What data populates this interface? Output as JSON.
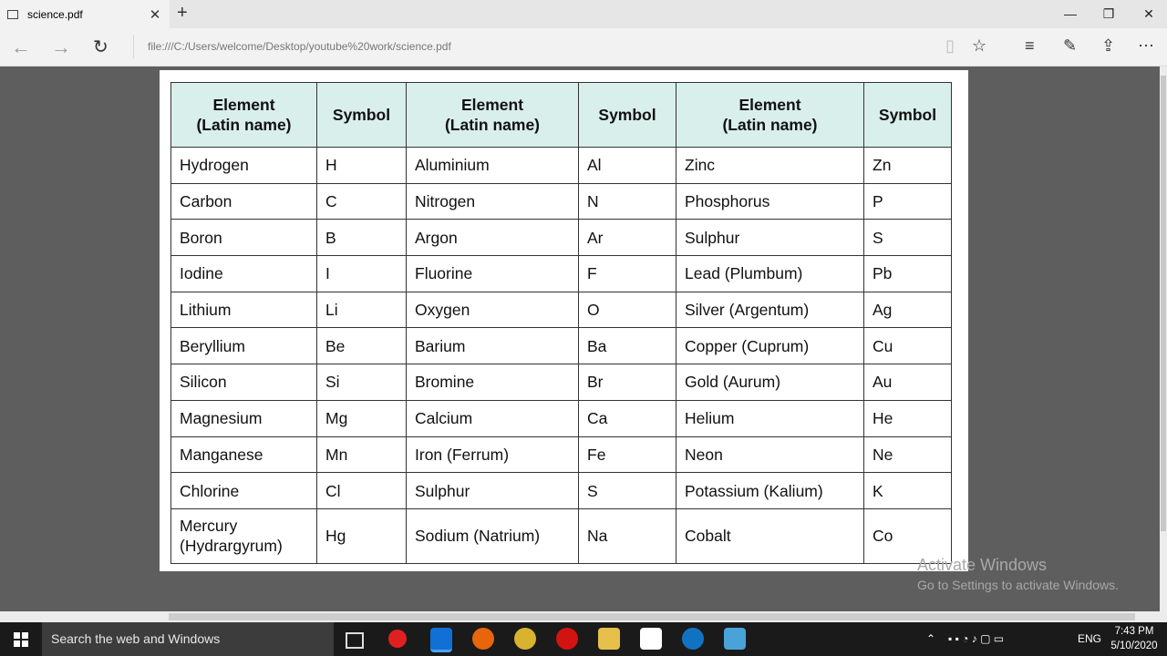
{
  "browser": {
    "tab_title": "science.pdf",
    "url": "file:///C:/Users/welcome/Desktop/youtube%20work/science.pdf",
    "window_controls": {
      "minimize": "—",
      "maximize": "❐",
      "close": "✕"
    }
  },
  "table": {
    "headers": [
      "Element\n(Latin name)",
      "Symbol",
      "Element\n(Latin name)",
      "Symbol",
      "Element\n(Latin name)",
      "Symbol"
    ],
    "rows": [
      [
        "Hydrogen",
        "H",
        "Aluminium",
        "Al",
        "Zinc",
        "Zn"
      ],
      [
        "Carbon",
        "C",
        "Nitrogen",
        "N",
        "Phosphorus",
        "P"
      ],
      [
        "Boron",
        "B",
        "Argon",
        "Ar",
        "Sulphur",
        "S"
      ],
      [
        "Iodine",
        "I",
        "Fluorine",
        "F",
        "Lead (Plumbum)",
        "Pb"
      ],
      [
        "Lithium",
        "Li",
        "Oxygen",
        "O",
        "Silver (Argentum)",
        "Ag"
      ],
      [
        "Beryllium",
        "Be",
        "Barium",
        "Ba",
        "Copper (Cuprum)",
        "Cu"
      ],
      [
        "Silicon",
        "Si",
        "Bromine",
        "Br",
        "Gold (Aurum)",
        "Au"
      ],
      [
        "Magnesium",
        "Mg",
        "Calcium",
        "Ca",
        "Helium",
        "He"
      ],
      [
        "Manganese",
        "Mn",
        "Iron (Ferrum)",
        "Fe",
        "Neon",
        "Ne"
      ],
      [
        "Chlorine",
        "Cl",
        "Sulphur",
        "S",
        "Potassium (Kalium)",
        "K"
      ],
      [
        "Mercury\n(Hydrargyrum)",
        "Hg",
        "Sodium (Natrium)",
        "Na",
        "Cobalt",
        "Co"
      ]
    ]
  },
  "watermark": {
    "line1": "Activate Windows",
    "line2": "Go to Settings to activate Windows."
  },
  "taskbar": {
    "search_placeholder": "Search the web and Windows",
    "language": "ENG",
    "time": "7:43 PM",
    "date": "5/10/2020"
  }
}
